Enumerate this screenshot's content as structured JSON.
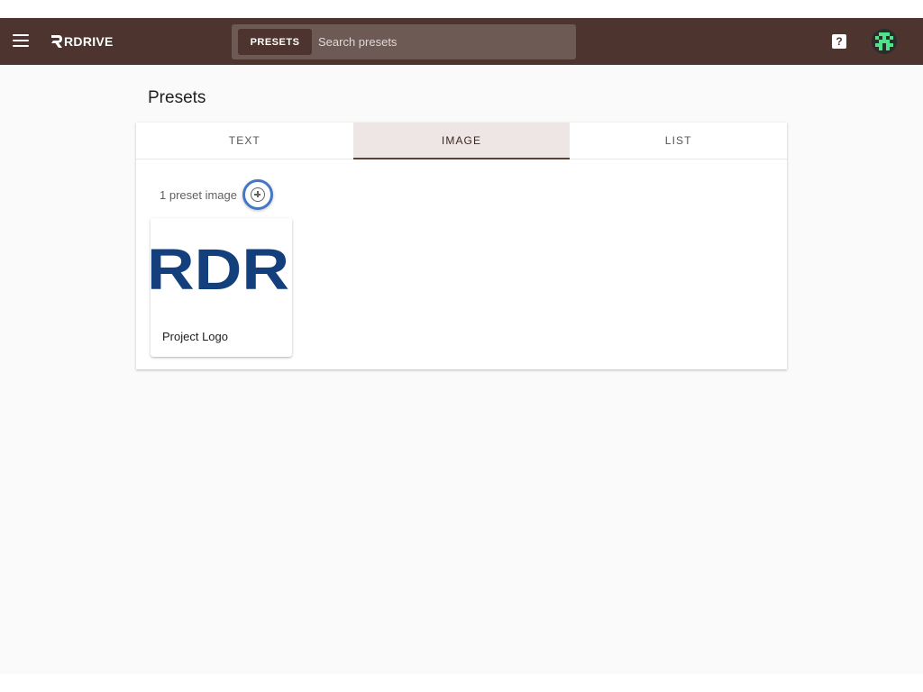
{
  "header": {
    "logo_text": "RDRIVE",
    "search_chip": "PRESETS",
    "search_placeholder": "Search presets",
    "help_label": "?"
  },
  "page": {
    "title": "Presets"
  },
  "tabs": [
    {
      "label": "TEXT",
      "active": false
    },
    {
      "label": "IMAGE",
      "active": true
    },
    {
      "label": "LIST",
      "active": false
    }
  ],
  "images_panel": {
    "count_text": "1 preset image",
    "items": [
      {
        "name": "Project Logo",
        "thumbnail_text": "RDR"
      }
    ]
  },
  "colors": {
    "header_bg": "#4e342e",
    "search_bg": "#6d5a55",
    "active_tab_bg": "#ede6e4",
    "highlight_ring": "#4677c4",
    "logo_blue": "#143f7d",
    "avatar_green": "#4ee38a"
  },
  "icons": {
    "menu": "menu-icon",
    "help": "help-icon",
    "add": "add-circle-icon",
    "avatar": "pixel-avatar"
  }
}
